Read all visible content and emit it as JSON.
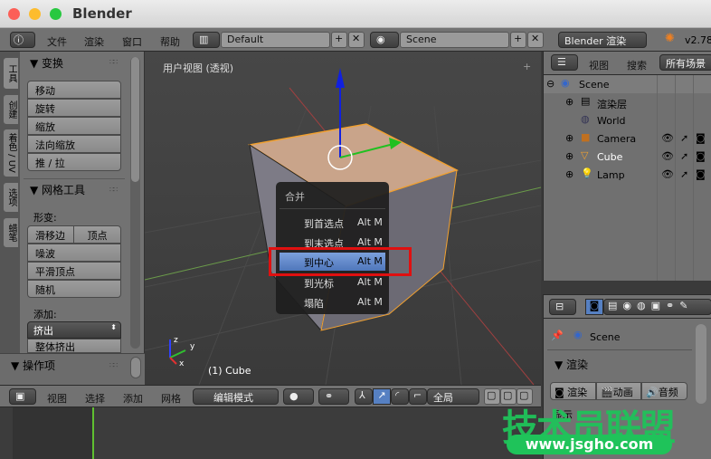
{
  "window": {
    "title": "Blender"
  },
  "info_header": {
    "menus": [
      "文件",
      "渲染",
      "窗口",
      "帮助"
    ],
    "layout": "Default",
    "scene": "Scene",
    "engine": "Blender 渲染",
    "version": "v2.78"
  },
  "tool_tabs": [
    "工具",
    "创建",
    "着色 / UV",
    "选项",
    "蜡笔"
  ],
  "tool_panel": {
    "transform_title": "变换",
    "transform_buttons": [
      "移动",
      "旋转",
      "缩放",
      "法向缩放",
      "推 / 拉"
    ],
    "mesh_title": "网格工具",
    "deform_label": "形变:",
    "deform_row": [
      "滑移边",
      "顶点"
    ],
    "deform_buttons": [
      "噪波",
      "平滑顶点",
      "随机"
    ],
    "add_label": "添加:",
    "extrude_select": "挤出",
    "add_buttons": [
      "整体挤出"
    ],
    "operator_title": "操作项"
  },
  "viewport": {
    "label": "用户视图 (透视)",
    "object_label": "(1) Cube",
    "axis_labels": [
      "z",
      "y",
      "x"
    ]
  },
  "merge_menu": {
    "title": "合并",
    "items": [
      {
        "label": "到首选点",
        "shortcut": "Alt M"
      },
      {
        "label": "到末选点",
        "shortcut": "Alt M"
      },
      {
        "label": "到中心",
        "shortcut": "Alt M",
        "highlighted": true
      },
      {
        "label": "到光标",
        "shortcut": "Alt M"
      },
      {
        "label": "塌陷",
        "shortcut": "Alt M"
      }
    ]
  },
  "view3d_header": {
    "menus": [
      "视图",
      "选择",
      "添加",
      "网格"
    ],
    "mode": "编辑模式",
    "orientation": "全局"
  },
  "outliner": {
    "menus": [
      "视图",
      "搜索"
    ],
    "filter": "所有场景",
    "items": [
      {
        "name": "Scene",
        "icon": "scene-icon"
      },
      {
        "name": "渲染层",
        "icon": "render-layers-icon"
      },
      {
        "name": "World",
        "icon": "world-icon"
      },
      {
        "name": "Camera",
        "icon": "camera-icon"
      },
      {
        "name": "Cube",
        "icon": "mesh-icon"
      },
      {
        "name": "Lamp",
        "icon": "lamp-icon"
      }
    ]
  },
  "properties": {
    "context": "Scene",
    "render_title": "渲染",
    "render_buttons": [
      "渲染",
      "动画",
      "音频"
    ],
    "display_label": "显示"
  },
  "watermark": {
    "text": "技术员联盟",
    "url": "www.jsgho.com"
  },
  "colors": {
    "selected": "#f0a030",
    "menu_highlight": "#5680c2",
    "annotation": "#e01010",
    "watermark": "#1fc35a"
  }
}
